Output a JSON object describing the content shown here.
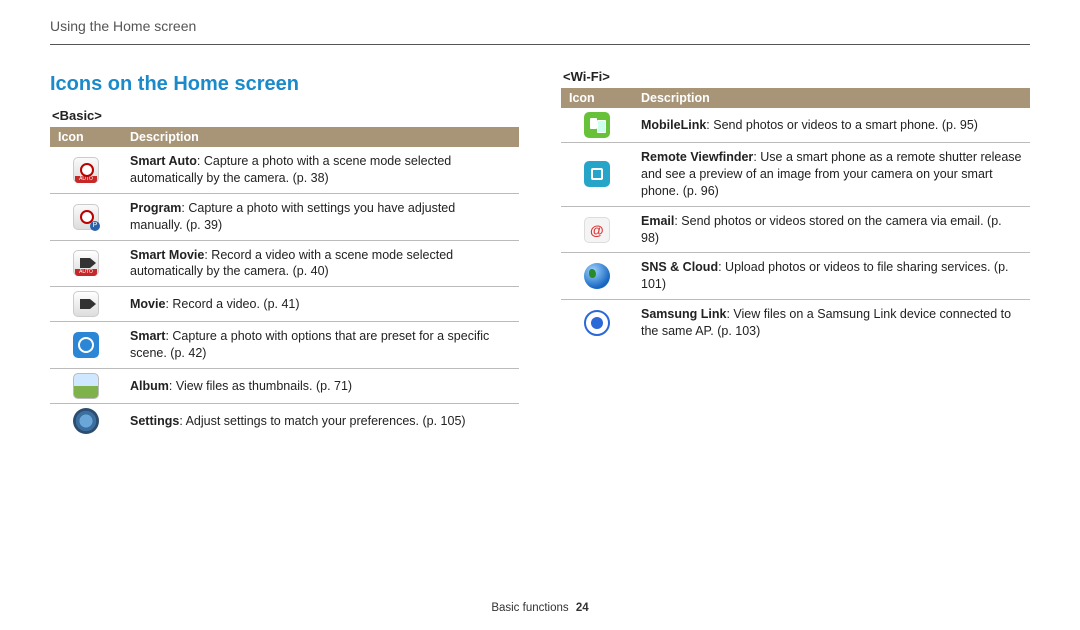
{
  "breadcrumb": "Using the Home screen",
  "section_title": "Icons on the Home screen",
  "basic": {
    "label": "<Basic>",
    "header_icon": "Icon",
    "header_desc": "Description",
    "rows": [
      {
        "icon": "smart-auto-icon",
        "term": "Smart Auto",
        "text": ": Capture a photo with a scene mode selected automatically by the camera. (p. 38)"
      },
      {
        "icon": "program-icon",
        "term": "Program",
        "text": ": Capture a photo with settings you have adjusted manually. (p. 39)"
      },
      {
        "icon": "smart-movie-icon",
        "term": "Smart Movie",
        "text": ": Record a video with a scene mode selected automatically by the camera. (p. 40)"
      },
      {
        "icon": "movie-icon",
        "term": "Movie",
        "text": ": Record a video. (p. 41)"
      },
      {
        "icon": "smart-icon",
        "term": "Smart",
        "text": ": Capture a photo with options that are preset for a specific scene. (p. 42)"
      },
      {
        "icon": "album-icon",
        "term": "Album",
        "text": ": View files as thumbnails. (p. 71)"
      },
      {
        "icon": "settings-icon",
        "term": "Settings",
        "text": ": Adjust settings to match your preferences. (p. 105)"
      }
    ]
  },
  "wifi": {
    "label": "<Wi-Fi>",
    "header_icon": "Icon",
    "header_desc": "Description",
    "rows": [
      {
        "icon": "mobilelink-icon",
        "term": "MobileLink",
        "text": ": Send photos or videos to a smart phone. (p. 95)"
      },
      {
        "icon": "remote-viewfinder-icon",
        "term": "Remote Viewfinder",
        "text": ": Use a smart phone as a remote shutter release and see a preview of an image from your camera on your smart phone. (p. 96)"
      },
      {
        "icon": "email-icon",
        "term": "Email",
        "text": ": Send photos or videos stored on the camera via email. (p. 98)"
      },
      {
        "icon": "sns-cloud-icon",
        "term": "SNS & Cloud",
        "text": ": Upload photos or videos to file sharing services. (p. 101)"
      },
      {
        "icon": "samsung-link-icon",
        "term": "Samsung Link",
        "text": ": View files on a Samsung Link device connected to the same AP. (p. 103)"
      }
    ]
  },
  "footer": {
    "section": "Basic functions",
    "page": "24"
  }
}
